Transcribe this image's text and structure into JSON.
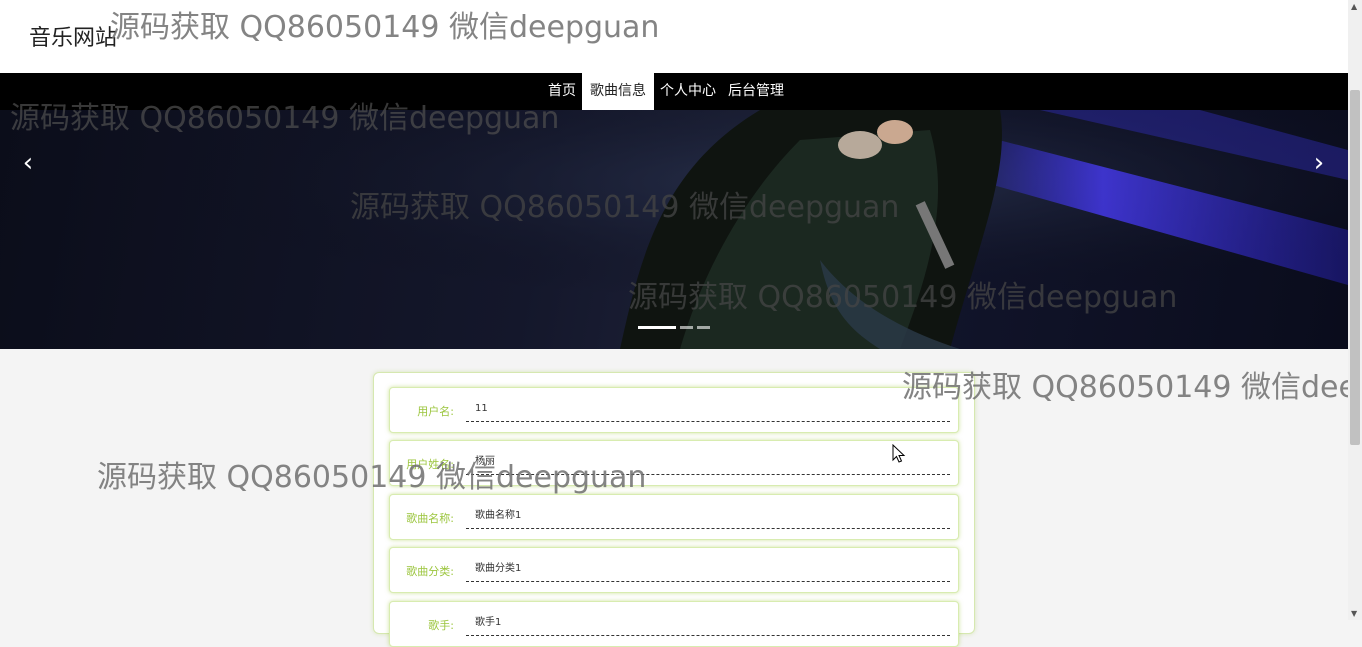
{
  "header": {
    "site_title": "音乐网站"
  },
  "nav": {
    "items": [
      {
        "label": "首页"
      },
      {
        "label": "歌曲信息"
      },
      {
        "label": "个人中心"
      },
      {
        "label": "后台管理"
      }
    ],
    "active": "歌曲信息"
  },
  "banner": {
    "prev_icon": "‹",
    "next_icon": "›",
    "slide_count": 3,
    "active_slide": 1
  },
  "form": {
    "rows": [
      {
        "label": "用户名:",
        "value": "11"
      },
      {
        "label": "用户姓名:",
        "value": "杨丽"
      },
      {
        "label": "歌曲名称:",
        "value": "歌曲名称1"
      },
      {
        "label": "歌曲分类:",
        "value": "歌曲分类1"
      },
      {
        "label": "歌手:",
        "value": "歌手1"
      }
    ]
  },
  "watermark": {
    "text": "源码获取 QQ86050149 微信deepguan"
  },
  "colors": {
    "accent": "#9bc53d",
    "nav_bg": "#000000",
    "nav_active_bg": "#ffffff"
  }
}
